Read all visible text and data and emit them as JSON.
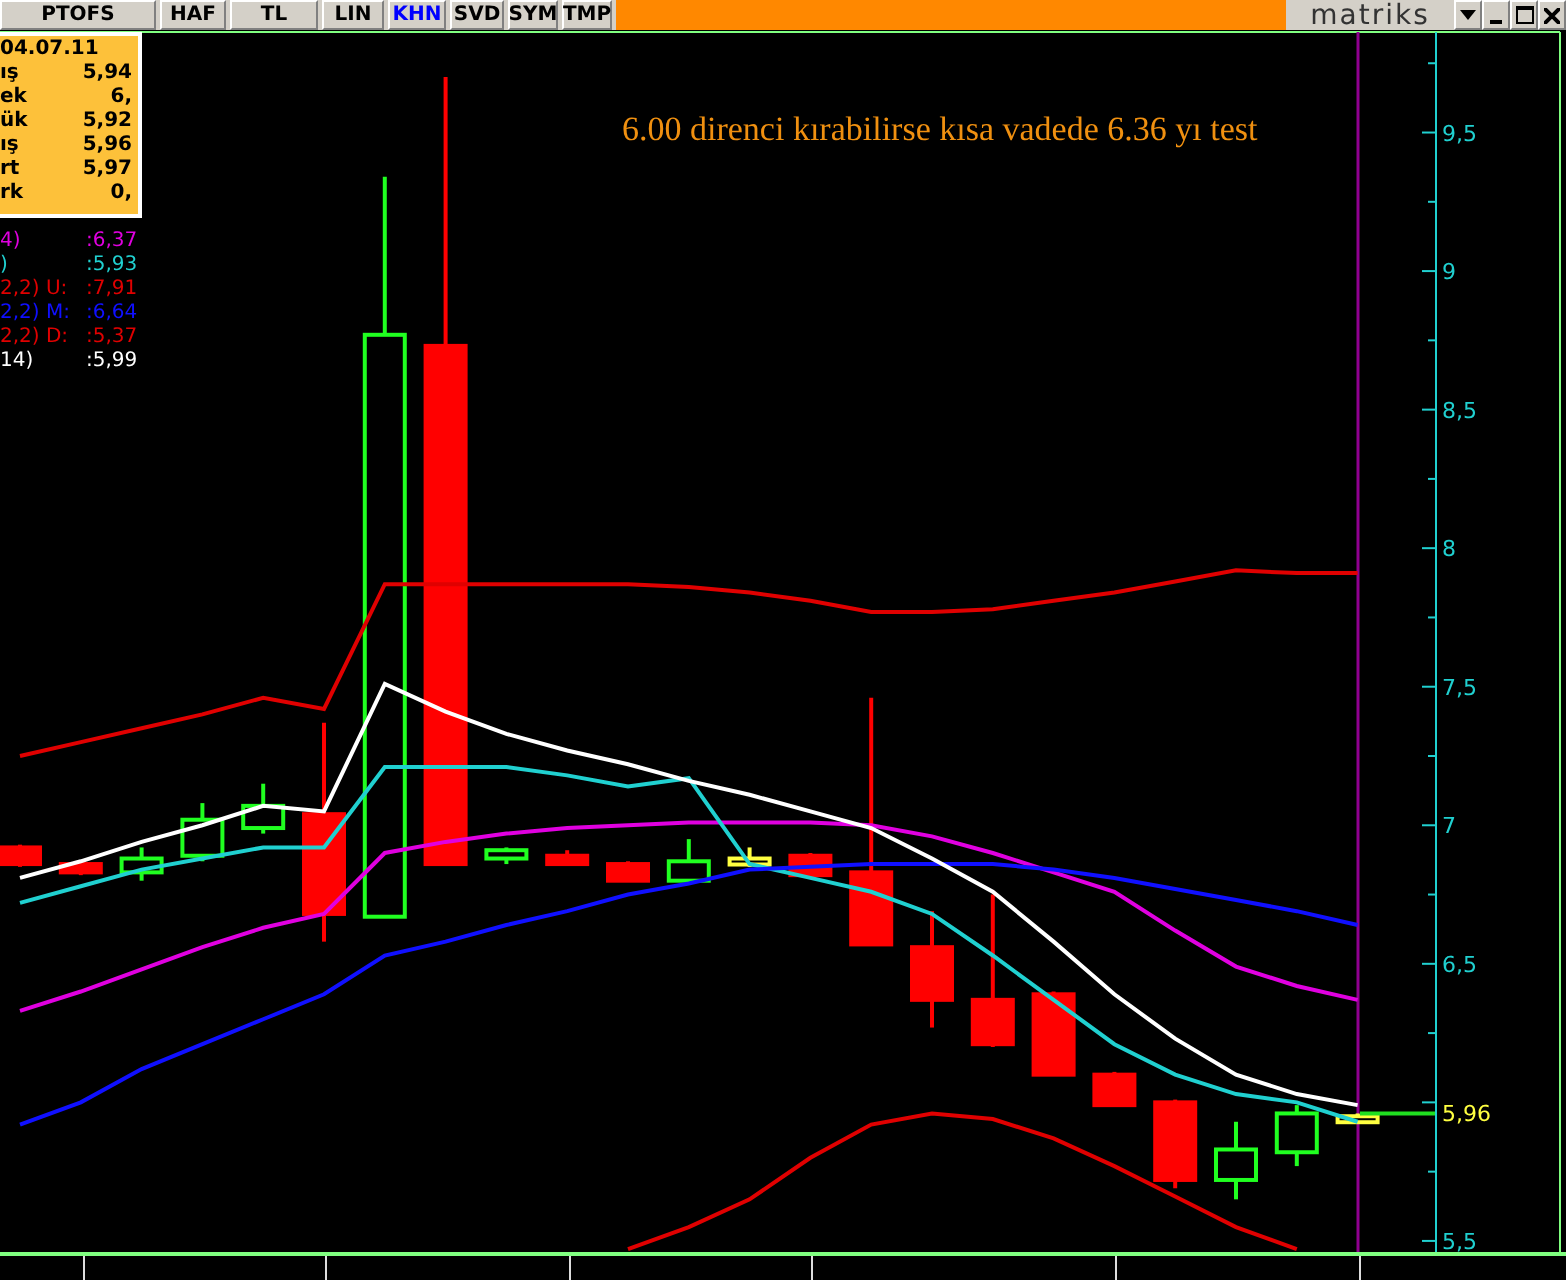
{
  "toolbar": {
    "tabs": [
      {
        "label": "PTOFS",
        "selected": false
      },
      {
        "label": "HAF",
        "selected": false
      },
      {
        "label": "TL",
        "selected": false
      },
      {
        "label": "LIN",
        "selected": false
      },
      {
        "label": "KHN",
        "selected": true
      },
      {
        "label": "SVD",
        "selected": false
      },
      {
        "label": "SYM",
        "selected": false
      },
      {
        "label": "TMP",
        "selected": false
      }
    ],
    "logo": "matriks"
  },
  "info_box": {
    "date": "04.07.11",
    "rows": [
      {
        "label": "ış",
        "value": "5,94"
      },
      {
        "label": "ek",
        "value": "6,"
      },
      {
        "label": "ük",
        "value": "5,92"
      },
      {
        "label": "ış",
        "value": "5,96"
      },
      {
        "label": "rt",
        "value": "5,97"
      },
      {
        "label": "rk",
        "value": "0,"
      }
    ]
  },
  "legend": [
    {
      "label": "4)",
      "value": ":6,37",
      "color": "#e000e0"
    },
    {
      "label": ")",
      "value": ":5,93",
      "color": "#20d0d0"
    },
    {
      "label": "2,2) U:",
      "value": ":7,91",
      "color": "#e00000"
    },
    {
      "label": "2,2) M:",
      "value": ":6,64",
      "color": "#1010ff"
    },
    {
      "label": "2,2) D:",
      "value": ":5,37",
      "color": "#e00000"
    },
    {
      "label": "14)",
      "value": ":5,99",
      "color": "#ffffff"
    }
  ],
  "annotation": "6.00 direnci kırabilirse kısa vadede 6.36 yı test",
  "last_price": "5,96",
  "chart_data": {
    "type": "line",
    "ylim": [
      5.46,
      9.87
    ],
    "yticks": [
      {
        "value": 5.5,
        "label": "5,5"
      },
      {
        "value": 6.5,
        "label": "6,5"
      },
      {
        "value": 7,
        "label": "7"
      },
      {
        "value": 7.5,
        "label": "7,5"
      },
      {
        "value": 8,
        "label": "8"
      },
      {
        "value": 8.5,
        "label": "8,5"
      },
      {
        "value": 9,
        "label": "9"
      },
      {
        "value": 9.5,
        "label": "9,5"
      }
    ],
    "series": [
      {
        "color": "#e000e0",
        "values": [
          6.33,
          6.4,
          6.48,
          6.56,
          6.63,
          6.68,
          6.9,
          6.94,
          6.97,
          6.99,
          7.0,
          7.01,
          7.01,
          7.01,
          7.0,
          6.96,
          6.9,
          6.83,
          6.76,
          6.62,
          6.49,
          6.42,
          6.37
        ]
      },
      {
        "color": "#20d0d0",
        "values": [
          6.72,
          6.78,
          6.84,
          6.88,
          6.92,
          6.92,
          7.21,
          7.21,
          7.21,
          7.18,
          7.14,
          7.17,
          6.86,
          6.81,
          6.76,
          6.68,
          6.53,
          6.37,
          6.21,
          6.1,
          6.03,
          6.0,
          5.93
        ]
      },
      {
        "color": "#e00000",
        "values": [
          7.25,
          7.3,
          7.35,
          7.4,
          7.46,
          7.42,
          7.87,
          7.87,
          7.87,
          7.87,
          7.87,
          7.86,
          7.84,
          7.81,
          7.77,
          7.77,
          7.78,
          7.81,
          7.84,
          7.88,
          7.92,
          7.91,
          7.91
        ]
      },
      {
        "color": "#1010ff",
        "values": [
          5.92,
          6.0,
          6.12,
          6.21,
          6.3,
          6.39,
          6.53,
          6.58,
          6.64,
          6.69,
          6.75,
          6.79,
          6.84,
          6.85,
          6.86,
          6.86,
          6.86,
          6.84,
          6.81,
          6.77,
          6.73,
          6.69,
          6.64
        ]
      },
      {
        "color": "#e00000",
        "values": [
          null,
          null,
          null,
          null,
          null,
          null,
          null,
          null,
          null,
          null,
          5.47,
          5.55,
          5.65,
          5.8,
          5.92,
          5.96,
          5.94,
          5.87,
          5.77,
          5.66,
          5.55,
          5.47,
          null
        ]
      },
      {
        "color": "#ffffff",
        "values": [
          6.81,
          6.87,
          6.94,
          7.0,
          7.07,
          7.05,
          7.51,
          7.41,
          7.33,
          7.27,
          7.22,
          7.16,
          7.11,
          7.05,
          6.99,
          6.88,
          6.76,
          6.58,
          6.39,
          6.23,
          6.1,
          6.03,
          5.99
        ]
      }
    ]
  }
}
